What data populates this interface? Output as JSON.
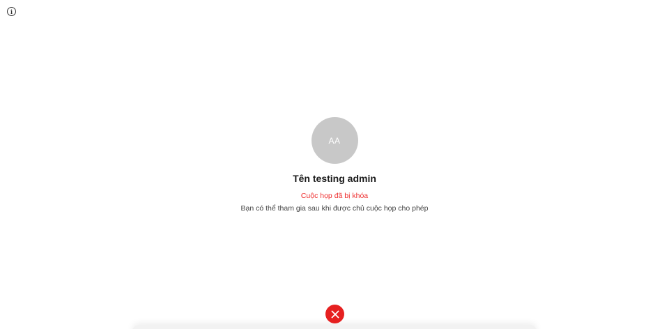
{
  "toolbar": {
    "info_icon": "info-icon",
    "info_glyph": "i"
  },
  "participant": {
    "avatar_initials": "AA",
    "name": "Tên testing admin"
  },
  "status": {
    "message": "Cuộc họp đã bị khóa",
    "color": "#ee2c2c"
  },
  "hint": {
    "message": "Bạn có thể tham gia sau khi được chủ cuộc họp cho phép"
  },
  "controls": {
    "close_icon": "close-icon",
    "close_color": "#e62020"
  }
}
